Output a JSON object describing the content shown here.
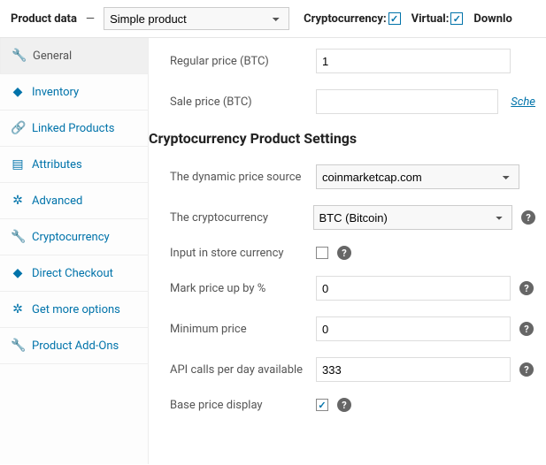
{
  "header": {
    "label": "Product data",
    "dash": "—",
    "product_type": "Simple product",
    "crypto_label": "Cryptocurrency:",
    "crypto_checked": true,
    "virtual_label": "Virtual:",
    "virtual_checked": true,
    "download_label": "Downlo"
  },
  "tabs": [
    {
      "id": "general",
      "icon": "🔧",
      "label": "General",
      "active": true
    },
    {
      "id": "inventory",
      "icon": "◆",
      "label": "Inventory",
      "active": false
    },
    {
      "id": "linked",
      "icon": "🔗",
      "label": "Linked Products",
      "active": false
    },
    {
      "id": "attributes",
      "icon": "▤",
      "label": "Attributes",
      "active": false
    },
    {
      "id": "advanced",
      "icon": "✲",
      "label": "Advanced",
      "active": false
    },
    {
      "id": "cryptocurrency",
      "icon": "🔧",
      "label": "Cryptocurrency",
      "active": false
    },
    {
      "id": "direct-checkout",
      "icon": "◆",
      "label": "Direct Checkout",
      "active": false
    },
    {
      "id": "get-more",
      "icon": "✲",
      "label": "Get more options",
      "active": false
    },
    {
      "id": "addons",
      "icon": "🔧",
      "label": "Product Add-Ons",
      "active": false
    }
  ],
  "fields": {
    "regular_price_label": "Regular price (BTC)",
    "regular_price_value": "1",
    "sale_price_label": "Sale price (BTC)",
    "sale_price_value": "",
    "schedule_link": "Sche",
    "section_title": "Cryptocurrency Product Settings",
    "price_source_label": "The dynamic price source",
    "price_source_value": "coinmarketcap.com",
    "crypto_label": "The cryptocurrency",
    "crypto_value": "BTC (Bitcoin)",
    "input_store_label": "Input in store currency",
    "input_store_checked": false,
    "markup_label": "Mark price up by %",
    "markup_value": "0",
    "min_price_label": "Minimum price",
    "min_price_value": "0",
    "api_calls_label": "API calls per day available",
    "api_calls_value": "333",
    "base_price_label": "Base price display",
    "base_price_checked": true
  }
}
